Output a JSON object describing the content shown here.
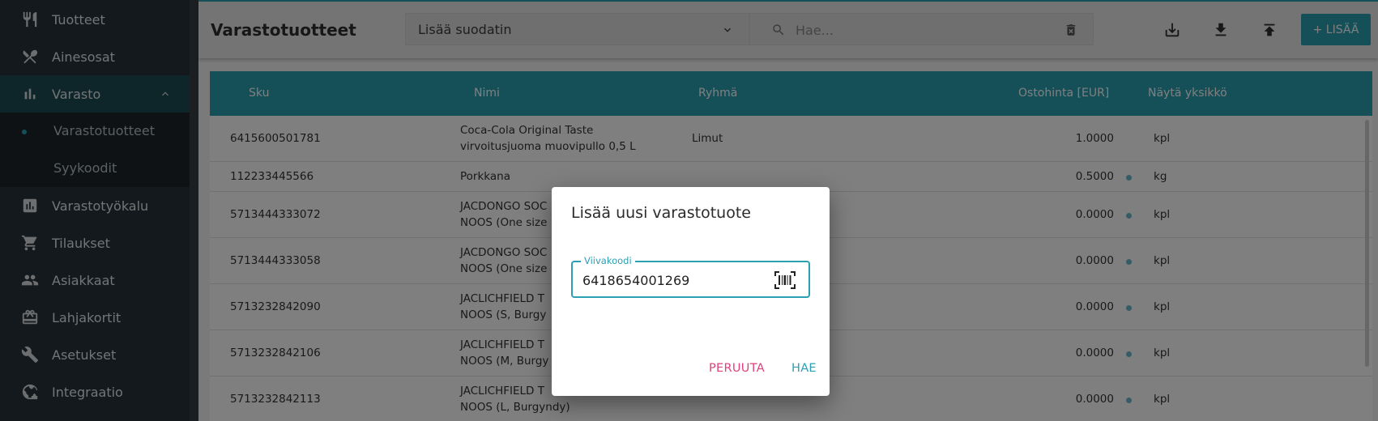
{
  "sidebar": {
    "items": [
      {
        "label": "Tuotteet",
        "icon": "fork-knife-icon"
      },
      {
        "label": "Ainesosat",
        "icon": "utensils-cross-icon"
      },
      {
        "label": "Varasto",
        "icon": "bar-chart-icon"
      },
      {
        "label": "Varastotyökalu",
        "icon": "chart-box-icon"
      },
      {
        "label": "Tilaukset",
        "icon": "cart-icon"
      },
      {
        "label": "Asiakkaat",
        "icon": "people-icon"
      },
      {
        "label": "Lahjakortit",
        "icon": "gift-card-icon"
      },
      {
        "label": "Asetukset",
        "icon": "wrench-icon"
      },
      {
        "label": "Integraatio",
        "icon": "globe-icon"
      }
    ],
    "subitems": [
      {
        "label": "Varastotuotteet"
      },
      {
        "label": "Syykoodit"
      }
    ]
  },
  "header": {
    "title": "Varastotuotteet",
    "filter_label": "Lisää suodatin",
    "search_placeholder": "Hae...",
    "add_label": "+ LISÄÄ"
  },
  "table": {
    "columns": [
      "Sku",
      "Nimi",
      "Ryhmä",
      "Ostohinta [EUR]",
      "Näytä yksikkö"
    ],
    "rows": [
      {
        "sku": "6415600501781",
        "name1": "Coca-Cola Original Taste",
        "name2": "virvoitusjuoma muovipullo 0,5 L",
        "group": "Limut",
        "price": "1.0000",
        "unit": "kpl"
      },
      {
        "sku": "112233445566",
        "name1": "Porkkana",
        "name2": "",
        "group": "",
        "price": "0.5000",
        "unit": "kg"
      },
      {
        "sku": "5713444333072",
        "name1": "JACDONGO SOC",
        "name2": "NOOS (One size",
        "group": "",
        "price": "0.0000",
        "unit": "kpl"
      },
      {
        "sku": "5713444333058",
        "name1": "JACDONGO SOC",
        "name2": "NOOS (One size",
        "group": "",
        "price": "0.0000",
        "unit": "kpl"
      },
      {
        "sku": "5713232842090",
        "name1": "JACLICHFIELD T",
        "name2": "NOOS (S, Burgy",
        "group": "",
        "price": "0.0000",
        "unit": "kpl"
      },
      {
        "sku": "5713232842106",
        "name1": "JACLICHFIELD T",
        "name2": "NOOS (M, Burgy",
        "group": "",
        "price": "0.0000",
        "unit": "kpl"
      },
      {
        "sku": "5713232842113",
        "name1": "JACLICHFIELD T",
        "name2": "NOOS (L, Burgyndy)",
        "group": "",
        "price": "0.0000",
        "unit": "kpl"
      }
    ]
  },
  "dialog": {
    "title": "Lisää uusi varastotuote",
    "field_label": "Viivakoodi",
    "field_value": "6418654001269",
    "cancel_label": "PERUUTA",
    "search_label": "HAE"
  },
  "colors": {
    "accent": "#2aa0b2",
    "sidebar": "#26323a",
    "cancel": "#e0407b"
  }
}
